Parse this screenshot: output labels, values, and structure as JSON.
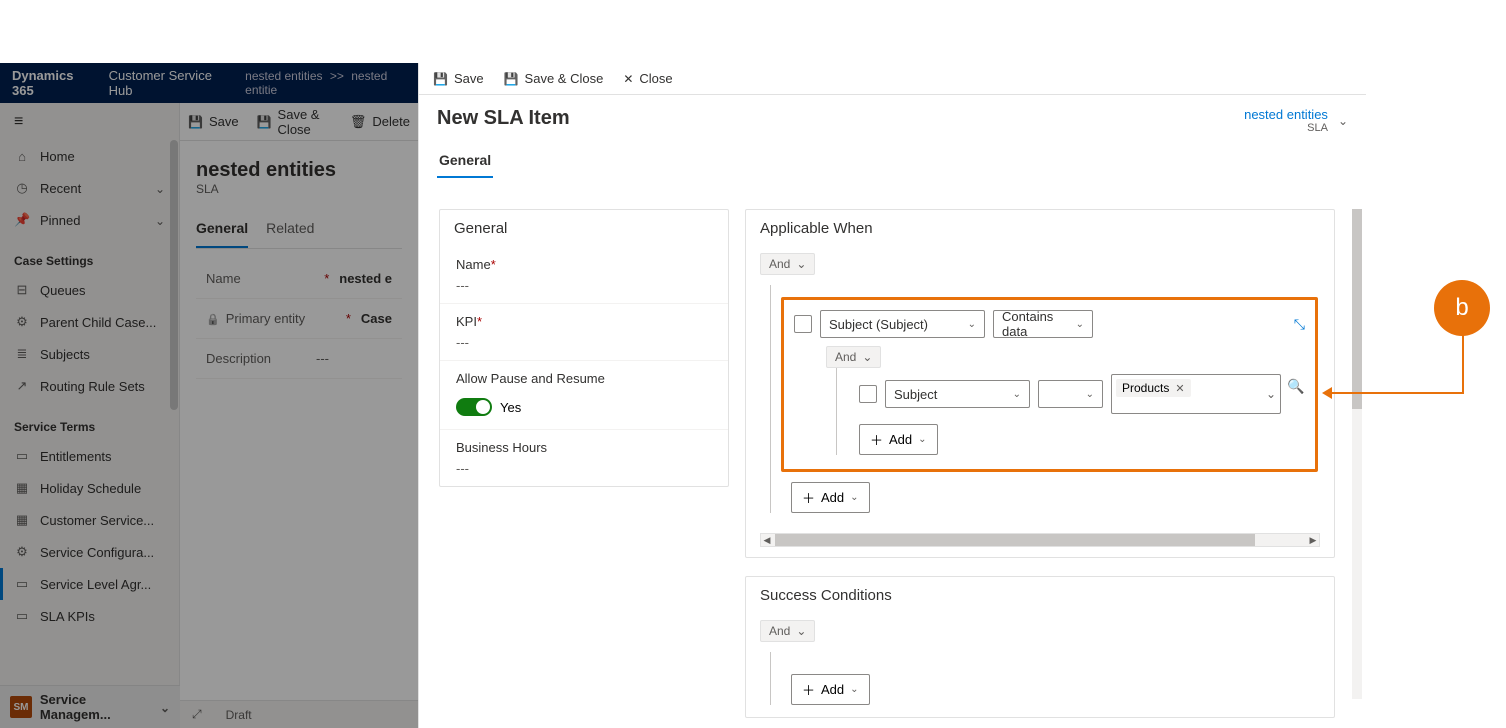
{
  "bg": {
    "product": "Dynamics 365",
    "hub": "Customer Service Hub",
    "breadcrumb1": "nested entities",
    "breadcrumb_sep": ">>",
    "breadcrumb2": "nested entitie",
    "cmd": {
      "save": "Save",
      "saveclose": "Save & Close",
      "delete": "Delete"
    },
    "sidebar": {
      "home": "Home",
      "recent": "Recent",
      "pinned": "Pinned",
      "section1": "Case Settings",
      "queues": "Queues",
      "parentchild": "Parent Child Case...",
      "subjects": "Subjects",
      "routing": "Routing Rule Sets",
      "section2": "Service Terms",
      "entitlements": "Entitlements",
      "holiday": "Holiday Schedule",
      "custsvc": "Customer Service...",
      "svcconfig": "Service Configura...",
      "sla": "Service Level Agr...",
      "slakpis": "SLA KPIs",
      "area": "Service Managem...",
      "area_tile": "SM"
    },
    "main": {
      "title": "nested entities",
      "subtitle": "SLA",
      "tabs": {
        "general": "General",
        "related": "Related"
      },
      "name_label": "Name",
      "name_value": "nested e",
      "primary_label": "Primary entity",
      "primary_value": "Case",
      "desc_label": "Description",
      "desc_value": "---"
    },
    "footer": {
      "status": "Draft"
    }
  },
  "panel": {
    "cmd": {
      "save": "Save",
      "saveclose": "Save & Close",
      "close": "Close"
    },
    "title": "New SLA Item",
    "crumb_title": "nested entities",
    "crumb_sub": "SLA",
    "tab": "General",
    "general_card": {
      "heading": "General",
      "name_label": "Name",
      "name_value": "---",
      "kpi_label": "KPI",
      "kpi_value": "---",
      "pause_label": "Allow Pause and Resume",
      "pause_value": "Yes",
      "hours_label": "Business Hours",
      "hours_value": "---"
    },
    "applicable": {
      "heading": "Applicable When",
      "and": "And",
      "field1": "Subject (Subject)",
      "op1": "Contains data",
      "nested_and": "And",
      "field2": "Subject",
      "tag": "Products",
      "add": "Add"
    },
    "success": {
      "heading": "Success Conditions",
      "and": "And",
      "add": "Add"
    }
  },
  "annotation": {
    "label": "b"
  }
}
